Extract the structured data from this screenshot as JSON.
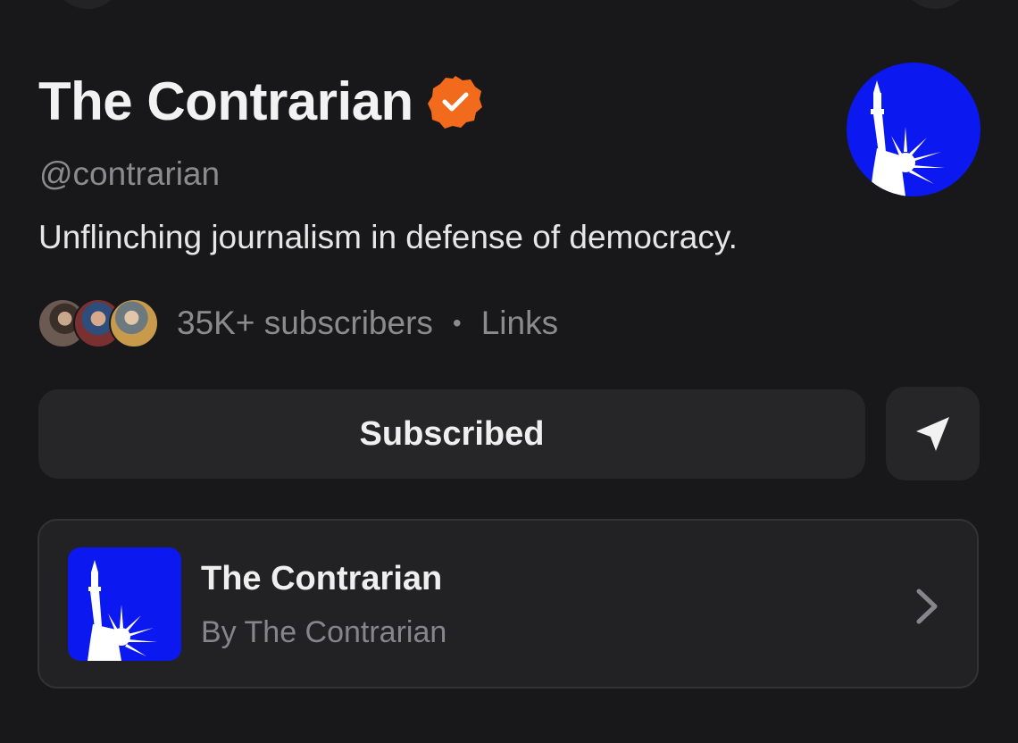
{
  "publication": {
    "title": "The Contrarian",
    "handle": "@contrarian",
    "tagline": "Unflinching journalism in defense of democracy.",
    "verified_color": "#f26a1b",
    "logo_color": "#0c18f0"
  },
  "stats": {
    "subscribers": "35K+ subscribers",
    "separator": "•",
    "links_label": "Links"
  },
  "actions": {
    "subscribed_label": "Subscribed",
    "share_icon": "send-icon"
  },
  "card": {
    "name": "The Contrarian",
    "author": "By The Contrarian"
  }
}
